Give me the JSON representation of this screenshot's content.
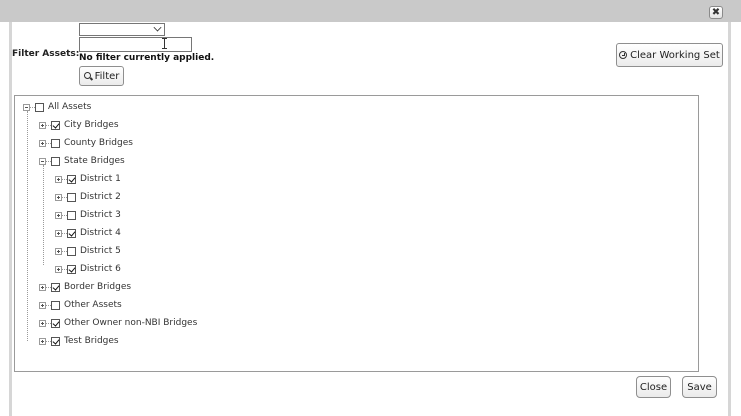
{
  "dialog": {
    "close_glyph": "✖"
  },
  "filter": {
    "label": "Filter Assets:",
    "select_value": "",
    "input_value": "",
    "status": "No filter currently applied.",
    "button_label": "Filter"
  },
  "toolbar": {
    "clear_label": "Clear Working Set"
  },
  "tree": {
    "root": {
      "label": "All Assets",
      "checked": false
    },
    "items": [
      {
        "label": "City Bridges",
        "checked": true
      },
      {
        "label": "County Bridges",
        "checked": false
      },
      {
        "label": "State Bridges",
        "checked": false,
        "expanded": true
      },
      {
        "label": "District 1",
        "checked": true
      },
      {
        "label": "District 2",
        "checked": false
      },
      {
        "label": "District 3",
        "checked": false
      },
      {
        "label": "District 4",
        "checked": true
      },
      {
        "label": "District 5",
        "checked": false
      },
      {
        "label": "District 6",
        "checked": true
      },
      {
        "label": "Border Bridges",
        "checked": true
      },
      {
        "label": "Other Assets",
        "checked": false
      },
      {
        "label": "Other Owner non-NBI Bridges",
        "checked": true
      },
      {
        "label": "Test Bridges",
        "checked": true
      }
    ]
  },
  "footer": {
    "close_label": "Close",
    "save_label": "Save"
  }
}
